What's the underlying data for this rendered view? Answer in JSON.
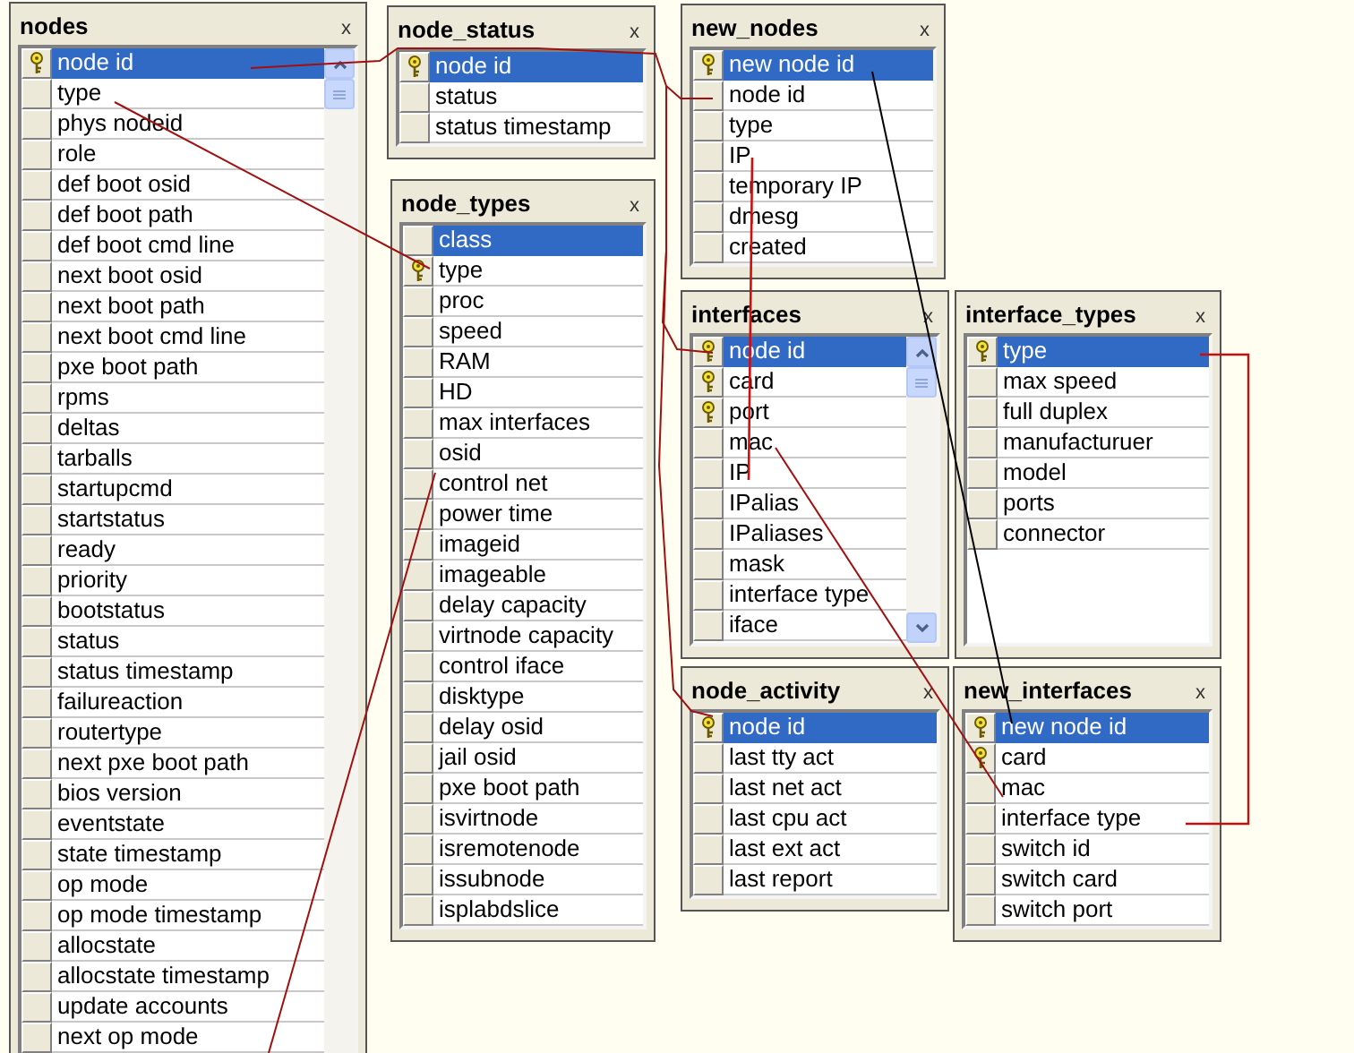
{
  "tables": [
    {
      "title": "nodes",
      "close": "x",
      "fields": [
        {
          "name": "node id",
          "key": true,
          "selected": true
        },
        {
          "name": "type",
          "key": false,
          "selected": false
        },
        {
          "name": "phys nodeid",
          "key": false,
          "selected": false
        },
        {
          "name": "role",
          "key": false,
          "selected": false
        },
        {
          "name": "def boot osid",
          "key": false,
          "selected": false
        },
        {
          "name": "def boot path",
          "key": false,
          "selected": false
        },
        {
          "name": "def boot cmd line",
          "key": false,
          "selected": false
        },
        {
          "name": "next boot osid",
          "key": false,
          "selected": false
        },
        {
          "name": "next boot path",
          "key": false,
          "selected": false
        },
        {
          "name": "next boot cmd line",
          "key": false,
          "selected": false
        },
        {
          "name": "pxe boot path",
          "key": false,
          "selected": false
        },
        {
          "name": "rpms",
          "key": false,
          "selected": false
        },
        {
          "name": "deltas",
          "key": false,
          "selected": false
        },
        {
          "name": "tarballs",
          "key": false,
          "selected": false
        },
        {
          "name": "startupcmd",
          "key": false,
          "selected": false
        },
        {
          "name": "startstatus",
          "key": false,
          "selected": false
        },
        {
          "name": "ready",
          "key": false,
          "selected": false
        },
        {
          "name": "priority",
          "key": false,
          "selected": false
        },
        {
          "name": "bootstatus",
          "key": false,
          "selected": false
        },
        {
          "name": "status",
          "key": false,
          "selected": false
        },
        {
          "name": "status timestamp",
          "key": false,
          "selected": false
        },
        {
          "name": "failureaction",
          "key": false,
          "selected": false
        },
        {
          "name": "routertype",
          "key": false,
          "selected": false
        },
        {
          "name": "next pxe boot path",
          "key": false,
          "selected": false
        },
        {
          "name": "bios version",
          "key": false,
          "selected": false
        },
        {
          "name": "eventstate",
          "key": false,
          "selected": false
        },
        {
          "name": "state timestamp",
          "key": false,
          "selected": false
        },
        {
          "name": "op mode",
          "key": false,
          "selected": false
        },
        {
          "name": "op mode timestamp",
          "key": false,
          "selected": false
        },
        {
          "name": "allocstate",
          "key": false,
          "selected": false
        },
        {
          "name": "allocstate timestamp",
          "key": false,
          "selected": false
        },
        {
          "name": "update accounts",
          "key": false,
          "selected": false
        },
        {
          "name": "next op mode",
          "key": false,
          "selected": false
        }
      ]
    },
    {
      "title": "node_status",
      "close": "x",
      "fields": [
        {
          "name": "node id",
          "key": true,
          "selected": true
        },
        {
          "name": "status",
          "key": false,
          "selected": false
        },
        {
          "name": "status timestamp",
          "key": false,
          "selected": false
        }
      ]
    },
    {
      "title": "node_types",
      "close": "x",
      "fields": [
        {
          "name": "class",
          "key": false,
          "selected": true
        },
        {
          "name": "type",
          "key": true,
          "selected": false
        },
        {
          "name": "proc",
          "key": false,
          "selected": false
        },
        {
          "name": "speed",
          "key": false,
          "selected": false
        },
        {
          "name": "RAM",
          "key": false,
          "selected": false
        },
        {
          "name": "HD",
          "key": false,
          "selected": false
        },
        {
          "name": "max interfaces",
          "key": false,
          "selected": false
        },
        {
          "name": "osid",
          "key": false,
          "selected": false
        },
        {
          "name": "control net",
          "key": false,
          "selected": false
        },
        {
          "name": "power time",
          "key": false,
          "selected": false
        },
        {
          "name": "imageid",
          "key": false,
          "selected": false
        },
        {
          "name": "imageable",
          "key": false,
          "selected": false
        },
        {
          "name": "delay capacity",
          "key": false,
          "selected": false
        },
        {
          "name": "virtnode capacity",
          "key": false,
          "selected": false
        },
        {
          "name": "control iface",
          "key": false,
          "selected": false
        },
        {
          "name": "disktype",
          "key": false,
          "selected": false
        },
        {
          "name": "delay osid",
          "key": false,
          "selected": false
        },
        {
          "name": "jail osid",
          "key": false,
          "selected": false
        },
        {
          "name": "pxe boot path",
          "key": false,
          "selected": false
        },
        {
          "name": "isvirtnode",
          "key": false,
          "selected": false
        },
        {
          "name": "isremotenode",
          "key": false,
          "selected": false
        },
        {
          "name": "issubnode",
          "key": false,
          "selected": false
        },
        {
          "name": "isplabdslice",
          "key": false,
          "selected": false
        }
      ]
    },
    {
      "title": "new_nodes",
      "close": "x",
      "fields": [
        {
          "name": "new node id",
          "key": true,
          "selected": true
        },
        {
          "name": "node id",
          "key": false,
          "selected": false
        },
        {
          "name": "type",
          "key": false,
          "selected": false
        },
        {
          "name": "IP",
          "key": false,
          "selected": false
        },
        {
          "name": "temporary IP",
          "key": false,
          "selected": false
        },
        {
          "name": "dmesg",
          "key": false,
          "selected": false
        },
        {
          "name": "created",
          "key": false,
          "selected": false
        }
      ]
    },
    {
      "title": "interfaces",
      "close": "x",
      "fields": [
        {
          "name": "node id",
          "key": true,
          "selected": true
        },
        {
          "name": "card",
          "key": true,
          "selected": false
        },
        {
          "name": "port",
          "key": true,
          "selected": false
        },
        {
          "name": "mac",
          "key": false,
          "selected": false
        },
        {
          "name": "IP",
          "key": false,
          "selected": false
        },
        {
          "name": "IPalias",
          "key": false,
          "selected": false
        },
        {
          "name": "IPaliases",
          "key": false,
          "selected": false
        },
        {
          "name": "mask",
          "key": false,
          "selected": false
        },
        {
          "name": "interface type",
          "key": false,
          "selected": false
        },
        {
          "name": "iface",
          "key": false,
          "selected": false
        }
      ]
    },
    {
      "title": "interface_types",
      "close": "x",
      "fields": [
        {
          "name": "type",
          "key": true,
          "selected": true
        },
        {
          "name": "max speed",
          "key": false,
          "selected": false
        },
        {
          "name": "full duplex",
          "key": false,
          "selected": false
        },
        {
          "name": "manufacturuer",
          "key": false,
          "selected": false
        },
        {
          "name": "model",
          "key": false,
          "selected": false
        },
        {
          "name": "ports",
          "key": false,
          "selected": false
        },
        {
          "name": "connector",
          "key": false,
          "selected": false
        }
      ]
    },
    {
      "title": "node_activity",
      "close": "x",
      "fields": [
        {
          "name": "node id",
          "key": true,
          "selected": true
        },
        {
          "name": "last tty act",
          "key": false,
          "selected": false
        },
        {
          "name": "last net act",
          "key": false,
          "selected": false
        },
        {
          "name": "last cpu act",
          "key": false,
          "selected": false
        },
        {
          "name": "last ext act",
          "key": false,
          "selected": false
        },
        {
          "name": "last report",
          "key": false,
          "selected": false
        }
      ]
    },
    {
      "title": "new_interfaces",
      "close": "x",
      "fields": [
        {
          "name": "new node id",
          "key": true,
          "selected": true
        },
        {
          "name": "card",
          "key": true,
          "selected": false
        },
        {
          "name": "mac",
          "key": false,
          "selected": false
        },
        {
          "name": "interface type",
          "key": false,
          "selected": false
        },
        {
          "name": "switch id",
          "key": false,
          "selected": false
        },
        {
          "name": "switch card",
          "key": false,
          "selected": false
        },
        {
          "name": "switch port",
          "key": false,
          "selected": false
        }
      ]
    }
  ]
}
